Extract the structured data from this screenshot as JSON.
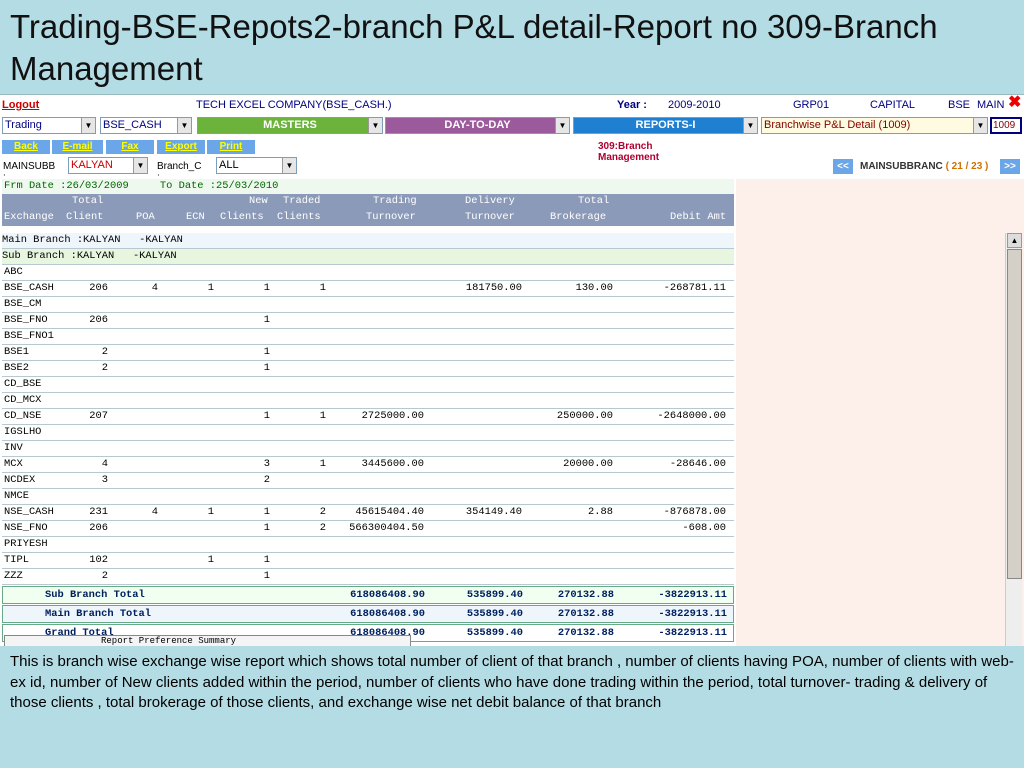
{
  "slide": {
    "title": "Trading-BSE-Repots2-branch P&L detail-Report no 309-Branch Management",
    "description": "This is branch wise exchange wise report which shows total number of client of that branch , number of clients having POA, number of clients with web-ex id, number of New clients added within the period, number of clients who have done trading within the period, total  turnover- trading & delivery of those clients , total brokerage of those clients, and exchange wise net debit balance of that branch"
  },
  "topbar": {
    "logout": "Logout",
    "company": "TECH EXCEL COMPANY(BSE_CASH.)",
    "year_label": "Year :",
    "year_value": "2009-2010",
    "group": "GRP01",
    "type": "CAPITAL",
    "exchange": "BSE",
    "main": "MAIN"
  },
  "selectors": {
    "module": "Trading",
    "segment": "BSE_CASH",
    "masters": "MASTERS",
    "daytoday": "DAY-TO-DAY",
    "reports": "REPORTS-I",
    "report_name": "Branchwise P&L Detail (1009)",
    "report_code": "1009"
  },
  "buttons": {
    "back": "Back",
    "email": "E-mail",
    "fax": "Fax",
    "export": "Export",
    "print": "Print"
  },
  "report_title": "309:Branch Management",
  "filters": {
    "mainsubb_label": "MAINSUBB :",
    "mainsubb_value": "KALYAN",
    "branch_label": "Branch_C :",
    "branch_value": "ALL"
  },
  "pager": {
    "prev": "<<",
    "label": "MAINSUBBRANC",
    "count": "( 21 / 23 )",
    "next": ">>"
  },
  "date_line": "Frm Date :26/03/2009     To Date :25/03/2010",
  "headers": {
    "line1": [
      "Total",
      "New",
      "Traded",
      "Trading",
      "Delivery",
      "Total"
    ],
    "line2": [
      "Exchange",
      "Client",
      "POA",
      "ECN",
      "Clients",
      "Clients",
      "Turnover",
      "Turnover",
      "Brokerage",
      "Debit Amt"
    ]
  },
  "main_branch": "Main Branch :KALYAN   -KALYAN",
  "sub_branch": "Sub Branch :KALYAN   -KALYAN",
  "rows": [
    {
      "ex": "ABC",
      "client": "",
      "poa": "",
      "ecn": "",
      "newc": "",
      "traded": "",
      "trading": "",
      "delivery": "",
      "brokerage": "",
      "debit": ""
    },
    {
      "ex": "BSE_CASH",
      "client": "206",
      "poa": "4",
      "ecn": "1",
      "newc": "1",
      "traded": "1",
      "trading": "",
      "delivery": "181750.00",
      "brokerage": "130.00",
      "debit": "-268781.11"
    },
    {
      "ex": "BSE_CM",
      "client": "",
      "poa": "",
      "ecn": "",
      "newc": "",
      "traded": "",
      "trading": "",
      "delivery": "",
      "brokerage": "",
      "debit": ""
    },
    {
      "ex": "BSE_FNO",
      "client": "206",
      "poa": "",
      "ecn": "",
      "newc": "1",
      "traded": "",
      "trading": "",
      "delivery": "",
      "brokerage": "",
      "debit": ""
    },
    {
      "ex": "BSE_FNO1",
      "client": "",
      "poa": "",
      "ecn": "",
      "newc": "",
      "traded": "",
      "trading": "",
      "delivery": "",
      "brokerage": "",
      "debit": ""
    },
    {
      "ex": "BSE1",
      "client": "2",
      "poa": "",
      "ecn": "",
      "newc": "1",
      "traded": "",
      "trading": "",
      "delivery": "",
      "brokerage": "",
      "debit": ""
    },
    {
      "ex": "BSE2",
      "client": "2",
      "poa": "",
      "ecn": "",
      "newc": "1",
      "traded": "",
      "trading": "",
      "delivery": "",
      "brokerage": "",
      "debit": ""
    },
    {
      "ex": "CD_BSE",
      "client": "",
      "poa": "",
      "ecn": "",
      "newc": "",
      "traded": "",
      "trading": "",
      "delivery": "",
      "brokerage": "",
      "debit": ""
    },
    {
      "ex": "CD_MCX",
      "client": "",
      "poa": "",
      "ecn": "",
      "newc": "",
      "traded": "",
      "trading": "",
      "delivery": "",
      "brokerage": "",
      "debit": ""
    },
    {
      "ex": "CD_NSE",
      "client": "207",
      "poa": "",
      "ecn": "",
      "newc": "1",
      "traded": "1",
      "trading": "2725000.00",
      "delivery": "",
      "brokerage": "250000.00",
      "debit": "-2648000.00"
    },
    {
      "ex": "IGSLHO",
      "client": "",
      "poa": "",
      "ecn": "",
      "newc": "",
      "traded": "",
      "trading": "",
      "delivery": "",
      "brokerage": "",
      "debit": ""
    },
    {
      "ex": "INV",
      "client": "",
      "poa": "",
      "ecn": "",
      "newc": "",
      "traded": "",
      "trading": "",
      "delivery": "",
      "brokerage": "",
      "debit": ""
    },
    {
      "ex": "MCX",
      "client": "4",
      "poa": "",
      "ecn": "",
      "newc": "3",
      "traded": "1",
      "trading": "3445600.00",
      "delivery": "",
      "brokerage": "20000.00",
      "debit": "-28646.00"
    },
    {
      "ex": "NCDEX",
      "client": "3",
      "poa": "",
      "ecn": "",
      "newc": "2",
      "traded": "",
      "trading": "",
      "delivery": "",
      "brokerage": "",
      "debit": ""
    },
    {
      "ex": "NMCE",
      "client": "",
      "poa": "",
      "ecn": "",
      "newc": "",
      "traded": "",
      "trading": "",
      "delivery": "",
      "brokerage": "",
      "debit": ""
    },
    {
      "ex": "NSE_CASH",
      "client": "231",
      "poa": "4",
      "ecn": "1",
      "newc": "1",
      "traded": "2",
      "trading": "45615404.40",
      "delivery": "354149.40",
      "brokerage": "2.88",
      "debit": "-876878.00"
    },
    {
      "ex": "NSE_FNO",
      "client": "206",
      "poa": "",
      "ecn": "",
      "newc": "1",
      "traded": "2",
      "trading": "566300404.50",
      "delivery": "",
      "brokerage": "",
      "debit": "-608.00"
    },
    {
      "ex": "PRIYESH",
      "client": "",
      "poa": "",
      "ecn": "",
      "newc": "",
      "traded": "",
      "trading": "",
      "delivery": "",
      "brokerage": "",
      "debit": ""
    },
    {
      "ex": "TIPL",
      "client": "102",
      "poa": "",
      "ecn": "1",
      "newc": "1",
      "traded": "",
      "trading": "",
      "delivery": "",
      "brokerage": "",
      "debit": ""
    },
    {
      "ex": "ZZZ",
      "client": "2",
      "poa": "",
      "ecn": "",
      "newc": "1",
      "traded": "",
      "trading": "",
      "delivery": "",
      "brokerage": "",
      "debit": ""
    }
  ],
  "totals": [
    {
      "label": "Sub Branch Total",
      "trading": "618086408.90",
      "delivery": "535899.40",
      "brokerage": "270132.88",
      "debit": "-3822913.11"
    },
    {
      "label": "Main Branch Total",
      "trading": "618086408.90",
      "delivery": "535899.40",
      "brokerage": "270132.88",
      "debit": "-3822913.11"
    },
    {
      "label": "Grand Total",
      "trading": "618086408.90",
      "delivery": "535899.40",
      "brokerage": "270132.88",
      "debit": "-3822913.11"
    }
  ],
  "footer_stub": "Report Preference Summary",
  "colors": {
    "masters": "#6cb33c",
    "daytoday": "#9b5a9b",
    "reports": "#1f7fd0",
    "header_band": "#8b9ab8",
    "slide_bg": "#b4dce4"
  }
}
